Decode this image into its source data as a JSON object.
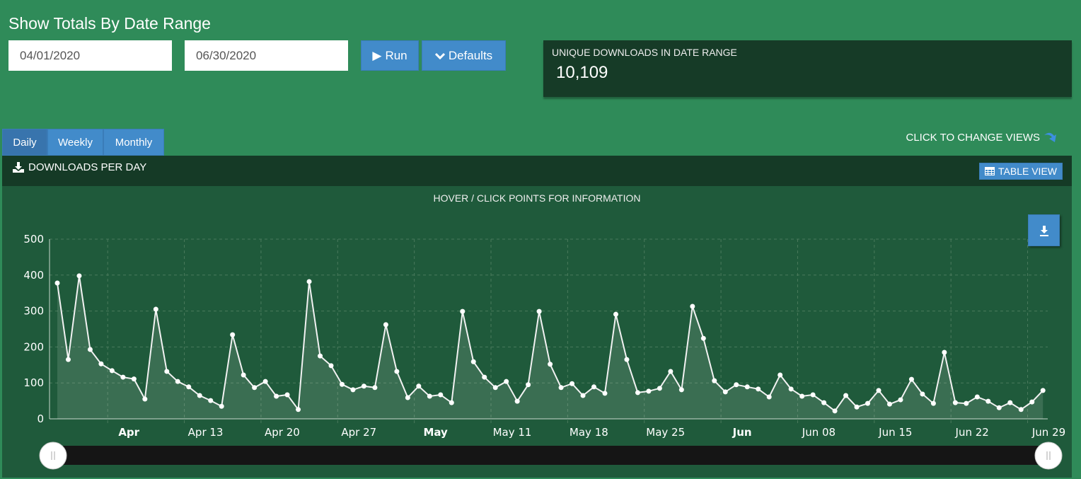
{
  "header": {
    "title": "Show Totals By Date Range"
  },
  "form": {
    "start_date": "04/01/2020",
    "end_date": "06/30/2020",
    "run_label": "Run",
    "defaults_label": "Defaults"
  },
  "stat": {
    "label": "UNIQUE DOWNLOADS IN DATE RANGE",
    "value": "10,109"
  },
  "tabs": [
    {
      "label": "Daily",
      "active": true
    },
    {
      "label": "Weekly"
    },
    {
      "label": "Monthly"
    }
  ],
  "change_views_label": "CLICK TO CHANGE VIEWS",
  "panel": {
    "title": "DOWNLOADS PER DAY",
    "table_view_label": "TABLE VIEW",
    "subtitle": "HOVER / CLICK POINTS FOR INFORMATION"
  },
  "colors": {
    "background": "#2f8b59",
    "panel": "#1f5a3b",
    "panel_header": "#153a26",
    "button": "#428bca",
    "line": "#f2f2f2"
  },
  "icons": {
    "run": "play-icon",
    "defaults": "chevron-down-icon",
    "panel": "download-icon",
    "table": "table-icon",
    "export": "download-icon",
    "change_views": "curved-arrow-down-icon"
  },
  "chart_data": {
    "type": "area",
    "interval": "daily",
    "x_start": "2020-04-01",
    "x_end": "2020-06-30",
    "ylim": [
      0,
      500
    ],
    "yticks": [
      0,
      100,
      200,
      300,
      400,
      500
    ],
    "grid": true,
    "xtick_labels": [
      {
        "date": "2020-04-06",
        "label": "Apr",
        "bold": true
      },
      {
        "date": "2020-04-13",
        "label": "Apr 13"
      },
      {
        "date": "2020-04-20",
        "label": "Apr 20"
      },
      {
        "date": "2020-04-27",
        "label": "Apr 27"
      },
      {
        "date": "2020-05-04",
        "label": "May",
        "bold": true
      },
      {
        "date": "2020-05-11",
        "label": "May 11"
      },
      {
        "date": "2020-05-18",
        "label": "May 18"
      },
      {
        "date": "2020-05-25",
        "label": "May 25"
      },
      {
        "date": "2020-06-01",
        "label": "Jun",
        "bold": true
      },
      {
        "date": "2020-06-08",
        "label": "Jun 08"
      },
      {
        "date": "2020-06-15",
        "label": "Jun 15"
      },
      {
        "date": "2020-06-22",
        "label": "Jun 22"
      },
      {
        "date": "2020-06-29",
        "label": "Jun 29"
      }
    ],
    "values": [
      378,
      165,
      398,
      193,
      153,
      134,
      116,
      111,
      55,
      305,
      132,
      104,
      89,
      65,
      51,
      35,
      234,
      122,
      87,
      104,
      63,
      67,
      26,
      382,
      175,
      148,
      96,
      81,
      91,
      87,
      262,
      132,
      59,
      91,
      63,
      67,
      45,
      299,
      159,
      116,
      87,
      104,
      49,
      95,
      299,
      152,
      87,
      98,
      65,
      89,
      71,
      291,
      165,
      73,
      77,
      85,
      132,
      81,
      313,
      224,
      106,
      75,
      95,
      89,
      83,
      61,
      122,
      83,
      63,
      67,
      45,
      22,
      65,
      33,
      43,
      79,
      41,
      53,
      110,
      69,
      43,
      185,
      45,
      43,
      61,
      49,
      31,
      45,
      26,
      47,
      79
    ],
    "navigator": {
      "range_start": "2020-04-01",
      "range_end": "2020-06-30"
    }
  }
}
